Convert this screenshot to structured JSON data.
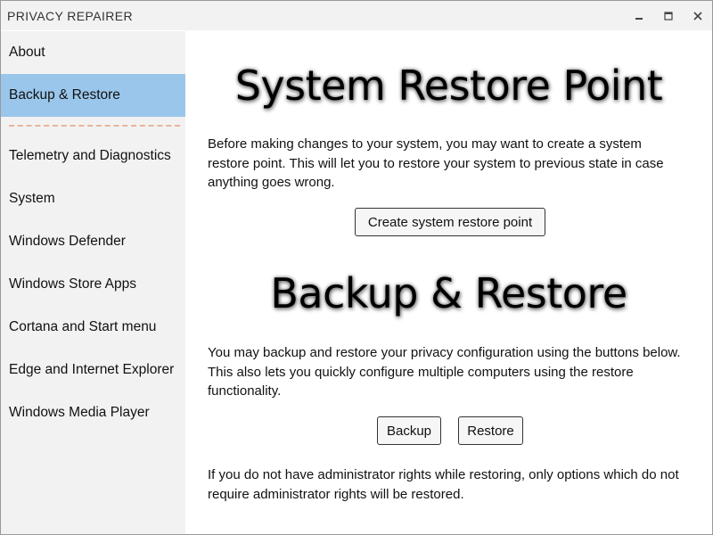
{
  "window": {
    "title": "PRIVACY REPAIRER",
    "controls": {
      "minimize_icon": "minimize-icon",
      "maximize_icon": "maximize-icon",
      "close_icon": "close-icon"
    }
  },
  "sidebar": {
    "items": [
      {
        "label": "About",
        "active": false
      },
      {
        "label": "Backup & Restore",
        "active": true
      },
      {
        "label": "Telemetry and Diagnostics",
        "active": false
      },
      {
        "label": "System",
        "active": false
      },
      {
        "label": "Windows Defender",
        "active": false
      },
      {
        "label": "Windows Store Apps",
        "active": false
      },
      {
        "label": "Cortana and Start menu",
        "active": false
      },
      {
        "label": "Edge and Internet Explorer",
        "active": false
      },
      {
        "label": "Windows Media Player",
        "active": false
      }
    ],
    "active_color": "#9ac6eb",
    "separator_color": "#e8b49a"
  },
  "main": {
    "restore_point": {
      "heading": "System Restore Point",
      "description": "Before making changes to your system, you may want to create a system restore point. This will let you to restore your system to previous state in case anything goes wrong.",
      "create_button": "Create system restore point"
    },
    "backup_restore": {
      "heading": "Backup & Restore",
      "description": "You may backup and restore your privacy configuration using the buttons below. This also lets you quickly configure multiple computers using the restore functionality.",
      "backup_button": "Backup",
      "restore_button": "Restore",
      "note": "If you do not have administrator rights while restoring, only options which do not require administrator rights will be restored."
    }
  }
}
